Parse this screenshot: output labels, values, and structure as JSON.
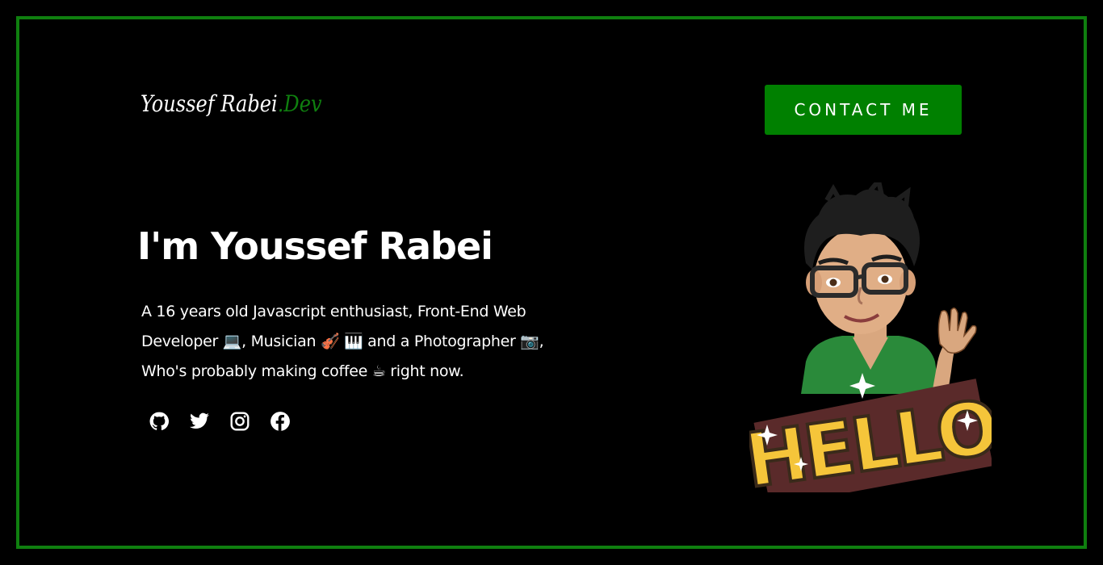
{
  "header": {
    "logo_name": "Youssef Rabei",
    "logo_suffix": ".Dev",
    "contact_label": "CONTACT ME"
  },
  "hero": {
    "title": "I'm Youssef Rabei",
    "bio_line_1": "A 16 years old Javascript enthusiast, Front-End Web",
    "bio_line_2": "Developer 💻, Musician 🎻 🎹 and a Photographer 📷,",
    "bio_line_3": "Who's probably making coffee ☕ right now.",
    "avatar_text": "HELLO"
  },
  "socials": [
    {
      "name": "github-icon"
    },
    {
      "name": "twitter-icon"
    },
    {
      "name": "instagram-icon"
    },
    {
      "name": "facebook-icon"
    }
  ],
  "colors": {
    "background": "#000000",
    "accent": "#008000",
    "border": "#0f7f0f",
    "text": "#ffffff"
  }
}
